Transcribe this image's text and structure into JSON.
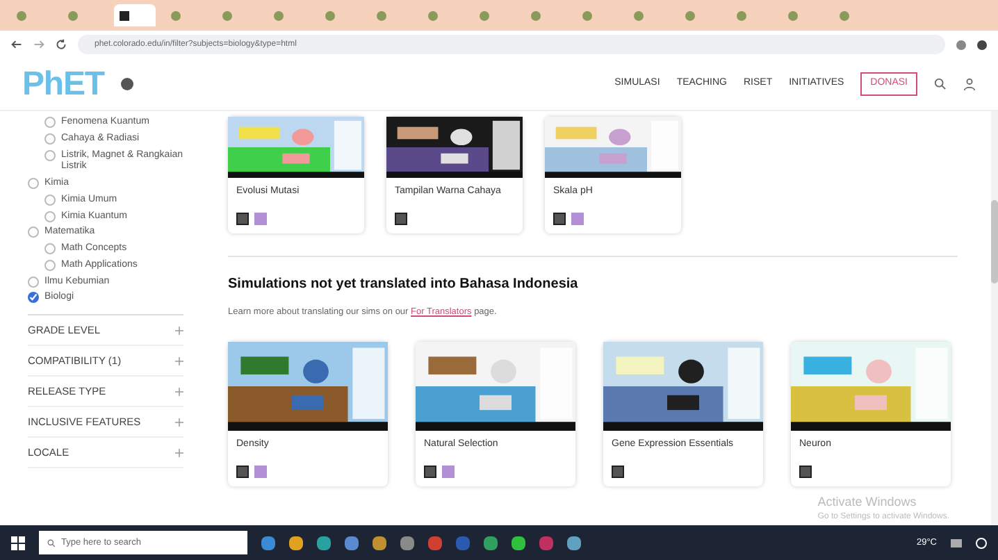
{
  "browser": {
    "tabs": [
      {
        "selected": false
      },
      {
        "selected": false
      },
      {
        "selected": true
      },
      {
        "selected": false
      },
      {
        "selected": false
      },
      {
        "selected": false
      },
      {
        "selected": false
      },
      {
        "selected": false
      },
      {
        "selected": false
      },
      {
        "selected": false
      },
      {
        "selected": false
      },
      {
        "selected": false
      },
      {
        "selected": false
      },
      {
        "selected": false
      },
      {
        "selected": false
      },
      {
        "selected": false
      },
      {
        "selected": false
      }
    ],
    "url": "phet.colorado.edu/in/filter?subjects=biology&type=html"
  },
  "header": {
    "logo": "PhET",
    "nav": [
      {
        "label": "SIMULASI"
      },
      {
        "label": "TEACHING"
      },
      {
        "label": "RISET"
      },
      {
        "label": "INITIATIVES"
      }
    ],
    "donate": "DONASI"
  },
  "sidebar": {
    "filters": [
      {
        "label": "Fenomena Kuantum",
        "checked": false
      },
      {
        "label": "Cahaya & Radiasi",
        "checked": false
      },
      {
        "label": "Listrik, Magnet & Rangkaian Listrik",
        "checked": false
      },
      {
        "label": "Kimia",
        "checked": false,
        "children": [
          {
            "label": "Kimia Umum",
            "checked": false
          },
          {
            "label": "Kimia Kuantum",
            "checked": false
          }
        ]
      },
      {
        "label": "Matematika",
        "checked": false,
        "children": [
          {
            "label": "Math Concepts",
            "checked": false
          },
          {
            "label": "Math Applications",
            "checked": false
          }
        ]
      },
      {
        "label": "Ilmu Kebumian",
        "checked": false
      },
      {
        "label": "Biologi",
        "checked": true
      }
    ],
    "sections": [
      {
        "label": "GRADE LEVEL",
        "expanded": false
      },
      {
        "label": "COMPATIBILITY (1)",
        "expanded": false
      },
      {
        "label": "RELEASE TYPE",
        "expanded": false
      },
      {
        "label": "INCLUSIVE FEATURES",
        "expanded": false
      },
      {
        "label": "LOCALE",
        "expanded": false
      }
    ]
  },
  "translated_sims": [
    {
      "title": "Evolusi Mutasi",
      "features": [
        {
          "kind": "html5"
        },
        {
          "kind": "interactive"
        }
      ]
    },
    {
      "title": "Tampilan Warna Cahaya",
      "features": [
        {
          "kind": "html5"
        }
      ]
    },
    {
      "title": "Skala pH",
      "features": [
        {
          "kind": "html5"
        },
        {
          "kind": "interactive"
        }
      ]
    }
  ],
  "untranslated": {
    "heading": "Simulations not yet translated into Bahasa Indonesia",
    "intro": "Learn more about translating our sims on our",
    "link": "For Translators",
    "intro_end": "page.",
    "sims": [
      {
        "title": "Density",
        "features": [
          {
            "kind": "html5"
          },
          {
            "kind": "interactive"
          }
        ]
      },
      {
        "title": "Natural Selection",
        "features": [
          {
            "kind": "html5"
          },
          {
            "kind": "interactive"
          }
        ]
      },
      {
        "title": "Gene Expression Essentials",
        "features": [
          {
            "kind": "html5"
          }
        ]
      },
      {
        "title": "Neuron",
        "features": [
          {
            "kind": "html5"
          }
        ]
      }
    ]
  },
  "activation": {
    "title": "Activate Windows",
    "text": "Go to Settings to activate Windows."
  },
  "taskbar": {
    "search_placeholder": "Type here to search",
    "weather": "29°C"
  }
}
